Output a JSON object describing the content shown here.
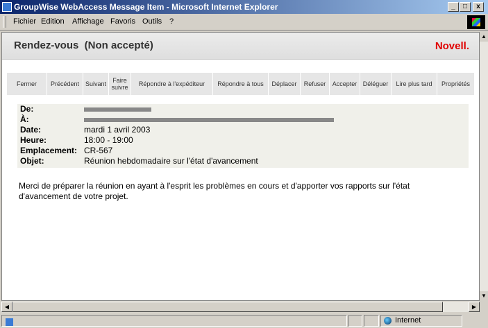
{
  "window": {
    "title": "GroupWise WebAccess Message Item - Microsoft Internet Explorer",
    "buttons": {
      "minimize": "_",
      "maximize": "□",
      "close": "x"
    }
  },
  "menu": [
    "Fichier",
    "Edition",
    "Affichage",
    "Favoris",
    "Outils",
    "?"
  ],
  "header": {
    "title": "Rendez-vous  (Non accepté)",
    "brand": "Novell."
  },
  "toolbar": [
    "Fermer",
    "Précédent",
    "Suivant",
    "Faire\nsuivre",
    "Répondre à l'expéditeur",
    "Répondre à tous",
    "Déplacer",
    "Refuser",
    "Accepter",
    "Déléguer",
    "Lire plus tard",
    "Propriétés"
  ],
  "message": {
    "from_label": "De:",
    "to_label": "À:",
    "date_label": "Date:",
    "date": "mardi 1 avril 2003",
    "time_label": "Heure:",
    "time": "18:00 - 19:00",
    "location_label": "Emplacement:",
    "location": "CR-567",
    "subject_label": "Objet:",
    "subject": "Réunion hebdomadaire sur l'état d'avancement",
    "body": "Merci de préparer la réunion en ayant à l'esprit les problèmes en cours et d'apporter vos rapports sur l'état d'avancement de votre projet."
  },
  "status": {
    "zone": "Internet"
  },
  "icons": [
    "ie-icon",
    "windows-logo-icon",
    "globe-icon",
    "page-icon"
  ]
}
